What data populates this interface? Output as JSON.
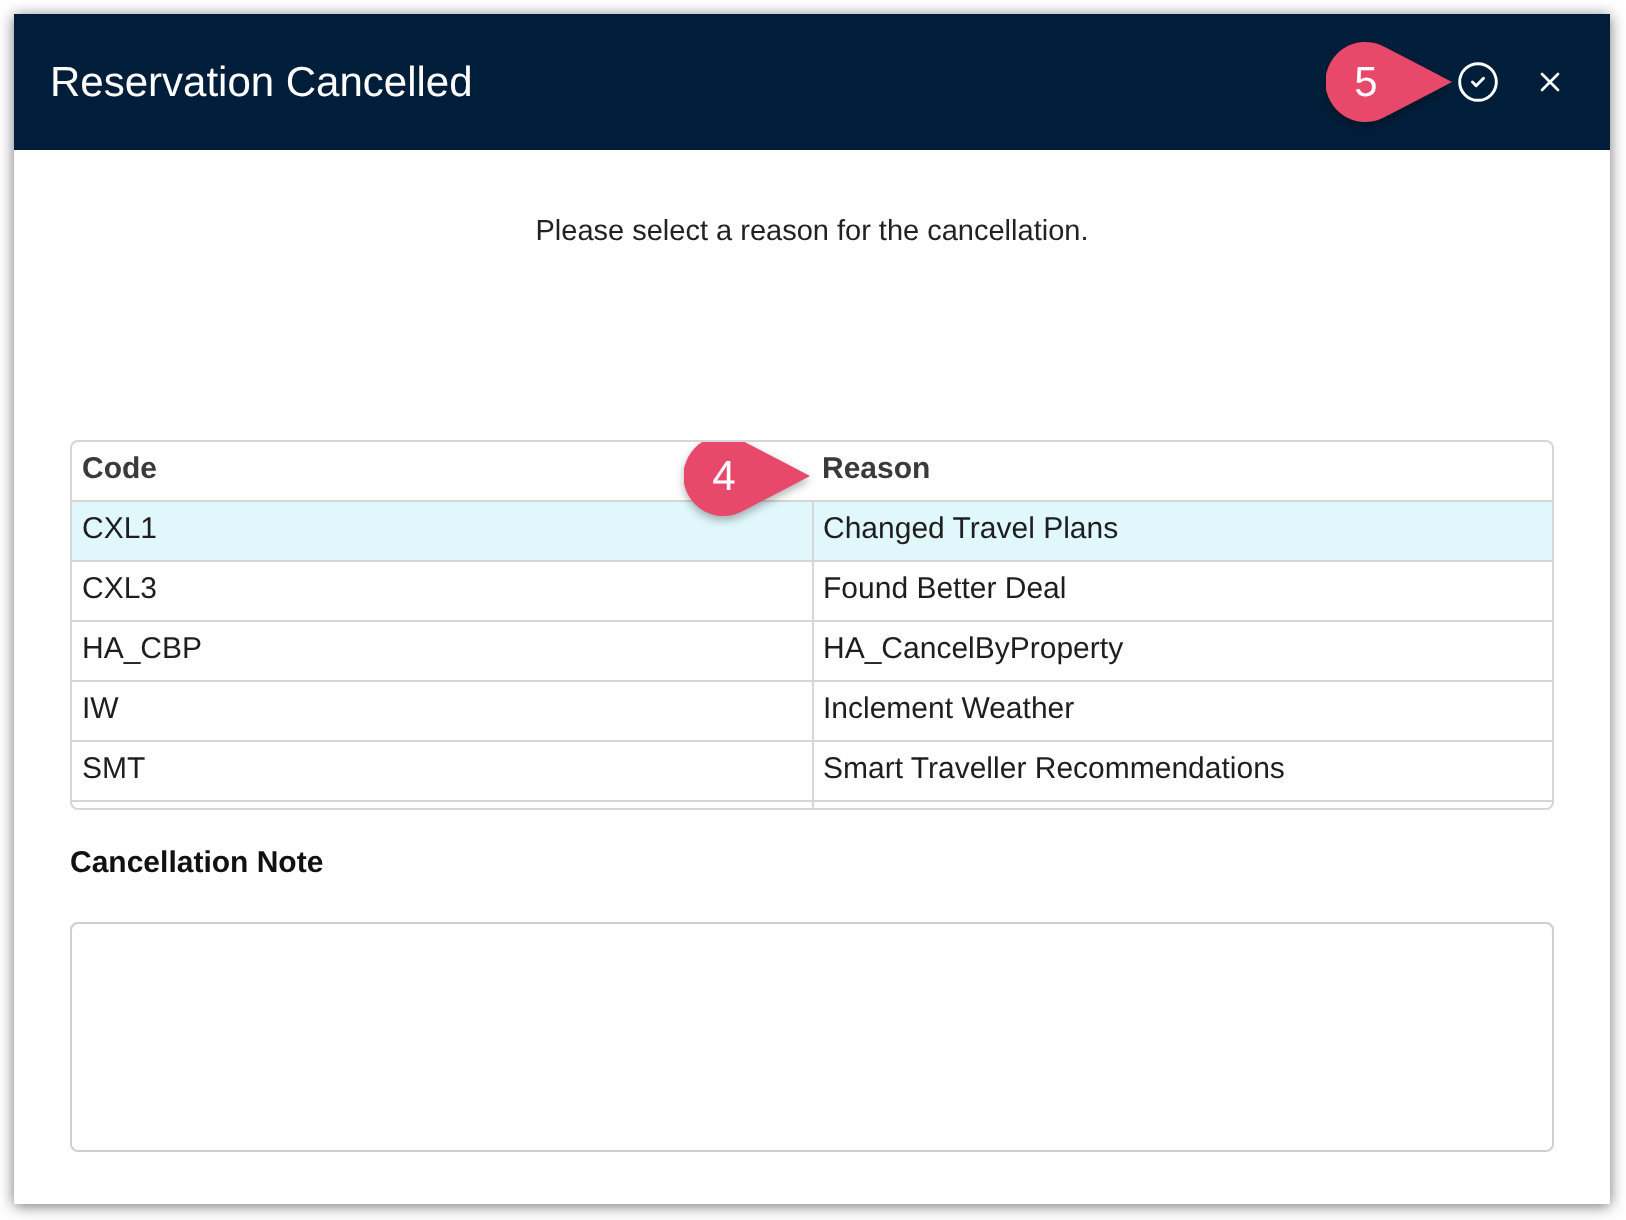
{
  "window": {
    "title": "Reservation Cancelled"
  },
  "instruction": "Please select a reason for the cancellation.",
  "table": {
    "columns": [
      "Code",
      "Reason"
    ],
    "rows": [
      {
        "code": "CXL1",
        "reason": "Changed Travel Plans",
        "selected": true
      },
      {
        "code": "CXL3",
        "reason": "Found Better Deal",
        "selected": false
      },
      {
        "code": "HA_CBP",
        "reason": "HA_CancelByProperty",
        "selected": false
      },
      {
        "code": "IW",
        "reason": "Inclement Weather",
        "selected": false
      },
      {
        "code": "SMT",
        "reason": "Smart Traveller Recommendations",
        "selected": false
      }
    ]
  },
  "note": {
    "label": "Cancellation Note"
  },
  "callouts": [
    {
      "label": "5"
    },
    {
      "label": "4"
    }
  ]
}
